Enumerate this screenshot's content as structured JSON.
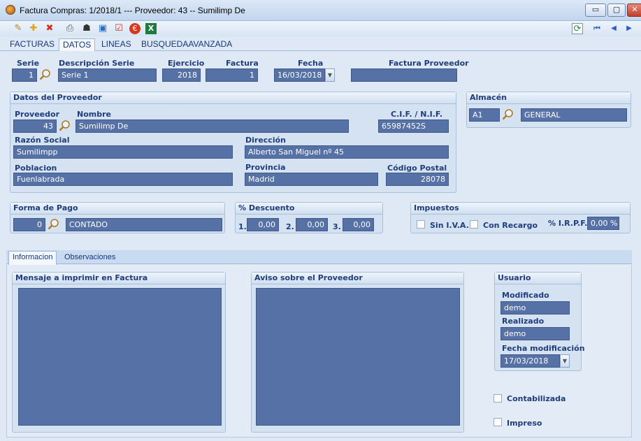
{
  "window": {
    "title": "Factura Compras: 1/2018/1  ---  Proveedor: 43  --  Sumilimp De",
    "min": "▭",
    "max": "▢",
    "close": "✕"
  },
  "toolbar": {
    "icons": [
      "edit-icon",
      "add-icon",
      "delete-icon",
      "print-icon",
      "user-icon",
      "window-icon",
      "checklist-icon",
      "euro-icon",
      "excel-icon",
      "refresh-icon",
      "first-icon",
      "prev-icon",
      "next-icon"
    ],
    "glyphs": {
      "edit": "✎",
      "add": "✚",
      "delete": "✖",
      "print": "⎙",
      "user": "☗",
      "window": "▣",
      "check": "☑",
      "euro": "€",
      "excel": "X",
      "refresh": "⟳",
      "first": "⏮",
      "prev": "◀",
      "next": "▶"
    }
  },
  "tabs": [
    "FACTURAS",
    "DATOS",
    "LINEAS",
    "BUSQUEDAAVANZADA"
  ],
  "header": {
    "serie_label": "Serie",
    "serie_value": "1",
    "desc_label": "Descripción Serie",
    "desc_value": "Serie 1",
    "ejercicio_label": "Ejercicio",
    "ejercicio_value": "2018",
    "factura_label": "Factura",
    "factura_value": "1",
    "fecha_label": "Fecha",
    "fecha_value": "16/03/2018",
    "fprov_label": "Factura Proveedor",
    "fprov_value": ""
  },
  "proveedor": {
    "title": "Datos del Proveedor",
    "proveedor_label": "Proveedor",
    "proveedor_value": "43",
    "nombre_label": "Nombre",
    "nombre_value": "Sumilimp De",
    "cif_label": "C.I.F. / N.I.F.",
    "cif_value": "65987452S",
    "razon_label": "Razón Social",
    "razon_value": "Sumilimpp",
    "direccion_label": "Dirección",
    "direccion_value": "Alberto San Miguel nº 45",
    "poblacion_label": "Poblacion",
    "poblacion_value": "Fuenlabrada",
    "provincia_label": "Provincia",
    "provincia_value": "Madrid",
    "cp_label": "Código Postal",
    "cp_value": "28078"
  },
  "almacen": {
    "title": "Almacén",
    "code": "A1",
    "name": "GENERAL"
  },
  "pago": {
    "title": "Forma de Pago",
    "code": "0",
    "name": "CONTADO"
  },
  "descuento": {
    "title": "% Descuento",
    "l1": "1.",
    "v1": "0,00",
    "l2": "2.",
    "v2": "0,00",
    "l3": "3.",
    "v3": "0,00"
  },
  "impuestos": {
    "title": "Impuestos",
    "sin_iva": "Sin I.V.A.",
    "con_recargo": "Con Recargo",
    "irpf_label": "% I.R.P.F.",
    "irpf_value": "0,00 %"
  },
  "subtabs": [
    "Informacion",
    "Observaciones"
  ],
  "mensaje": {
    "title": "Mensaje a imprimir en Factura"
  },
  "aviso": {
    "title": "Aviso sobre el Proveedor"
  },
  "usuario": {
    "title": "Usuario",
    "modificado_label": "Modificado",
    "modificado_value": "demo",
    "realizado_label": "Realizado",
    "realizado_value": "demo",
    "fecha_label": "Fecha modificación",
    "fecha_value": "17/03/2018"
  },
  "checks": {
    "contabilizada": "Contabilizada",
    "impreso": "Impreso"
  }
}
